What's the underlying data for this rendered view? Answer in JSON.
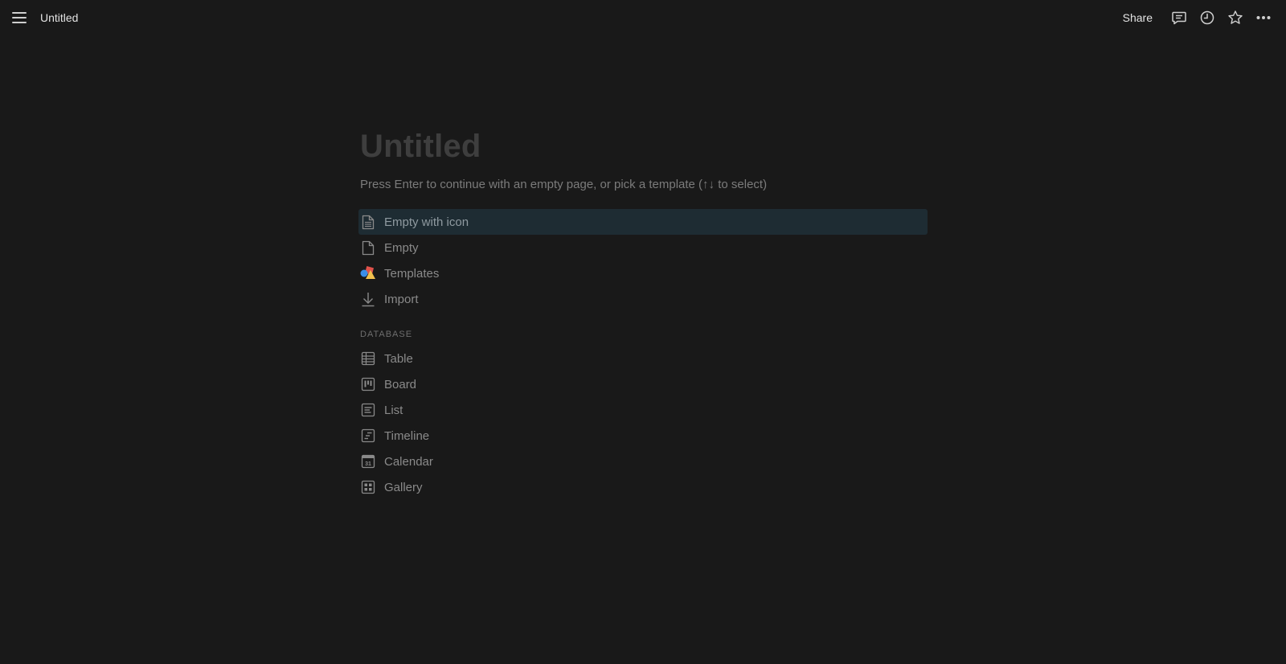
{
  "topbar": {
    "menu_icon": "hamburger-menu-icon",
    "page_name": "Untitled",
    "share_label": "Share",
    "comment_icon": "comment-icon",
    "updates_icon": "clock-icon",
    "favorite_icon": "star-icon",
    "more_icon": "more-horizontal-icon"
  },
  "page": {
    "title_placeholder": "Untitled",
    "hint": "Press Enter to continue with an empty page, or pick a template (↑↓ to select)"
  },
  "options": [
    {
      "label": "Empty with icon",
      "icon": "document-lines-icon",
      "selected": true
    },
    {
      "label": "Empty",
      "icon": "document-icon",
      "selected": false
    },
    {
      "label": "Templates",
      "icon": "templates-shapes-icon",
      "selected": false
    },
    {
      "label": "Import",
      "icon": "import-arrow-icon",
      "selected": false
    }
  ],
  "database": {
    "section_label": "DATABASE",
    "items": [
      {
        "label": "Table",
        "icon": "table-icon"
      },
      {
        "label": "Board",
        "icon": "board-icon"
      },
      {
        "label": "List",
        "icon": "list-icon"
      },
      {
        "label": "Timeline",
        "icon": "timeline-icon"
      },
      {
        "label": "Calendar",
        "icon": "calendar-icon",
        "icon_text": "31"
      },
      {
        "label": "Gallery",
        "icon": "gallery-icon"
      }
    ]
  },
  "colors": {
    "background": "#191919",
    "selected_row": "#1e2c33",
    "title_placeholder": "#3e3e3e",
    "muted_text": "#8a8a8a",
    "templates_red": "#e0524b",
    "templates_yellow": "#f2c14e",
    "templates_blue": "#3b8ee8"
  }
}
